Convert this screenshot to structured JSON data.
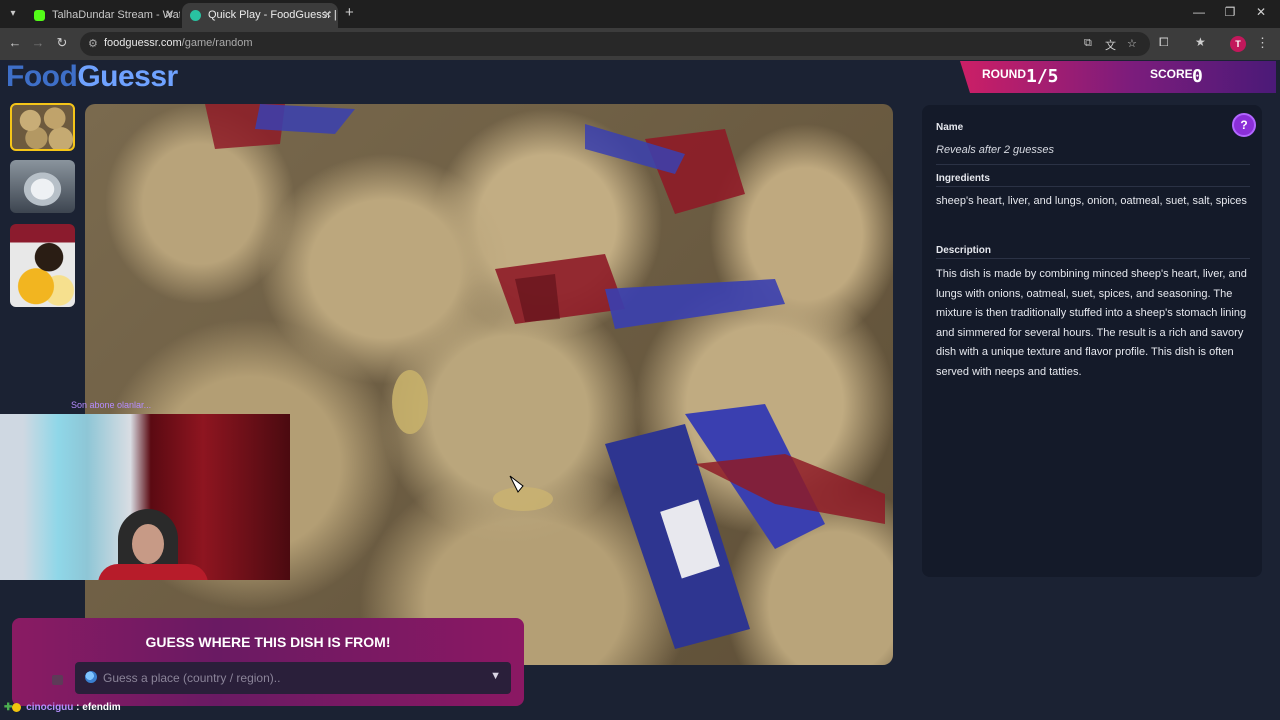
{
  "browser": {
    "tabs": [
      {
        "title": "TalhaDundar Stream - Watch Li",
        "active": false
      },
      {
        "title": "Quick Play - FoodGuessr | Food",
        "active": true
      }
    ],
    "url_prefix": "foodguessr.com",
    "url_path": "/game/random",
    "profile_initial": "T"
  },
  "header": {
    "logo_part1": "Food",
    "logo_part2": "Guessr",
    "round_label": "ROUND",
    "round_value": "1/5",
    "score_label": "SCORE",
    "score_value": "0"
  },
  "thumbnails": [
    "haggis",
    "coffee",
    "plate"
  ],
  "info": {
    "name_label": "Name",
    "name_value": "Reveals after 2 guesses",
    "ingredients_label": "Ingredients",
    "ingredients_value": "sheep's heart, liver, and lungs, onion, oatmeal, suet, salt, spices",
    "description_label": "Description",
    "description_value": "This dish is made by combining minced sheep's heart, liver, and lungs with onions, oatmeal, suet, spices, and seasoning. The mixture is then traditionally stuffed into a sheep's stomach lining and simmered for several hours. The result is a rich and savory dish with a unique texture and flavor profile. This dish is often served with neeps and tatties."
  },
  "overlay": {
    "cam_caption": "Son abone olanlar..."
  },
  "guess": {
    "title": "GUESS WHERE THIS DISH IS FROM!",
    "placeholder": "Guess a place (country / region).."
  },
  "chat": {
    "user": "cinociguu",
    "separator": " : ",
    "message": "efendim"
  },
  "colors": {
    "background": "#1b2233",
    "panel": "#141a29",
    "accent_pink": "#cc1f66",
    "accent_purple": "#8b2fd8",
    "logo_blue": "#6fa2ff"
  }
}
